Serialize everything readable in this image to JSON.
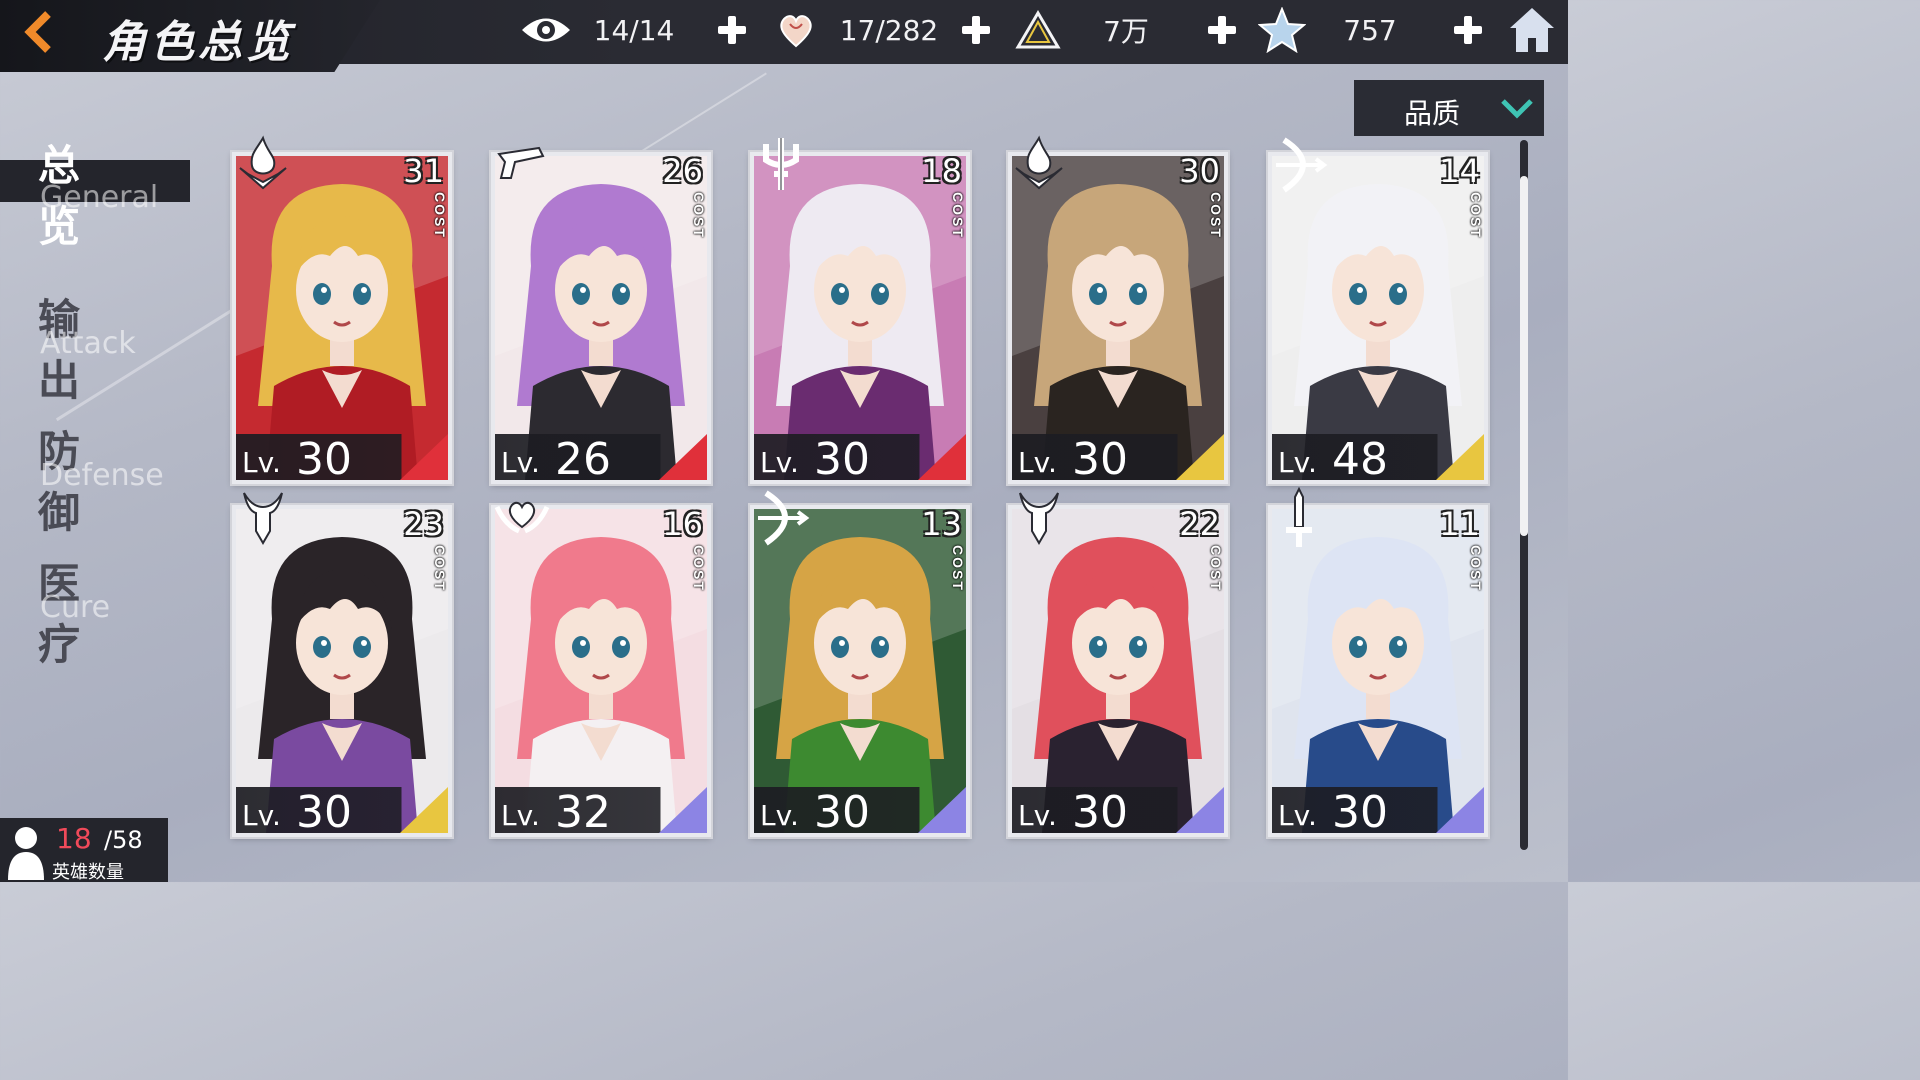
{
  "header": {
    "title": "角色总览",
    "resources": [
      {
        "icon": "eye-icon",
        "value": "14/14"
      },
      {
        "icon": "heart-icon",
        "value": "17/282"
      },
      {
        "icon": "crystal-triangle-icon",
        "value": "7万"
      },
      {
        "icon": "star-icon",
        "value": "757"
      }
    ]
  },
  "sort": {
    "label": "品质"
  },
  "categories": [
    {
      "zh": "总览",
      "en": "General",
      "active": true
    },
    {
      "zh": "输出",
      "en": "Attack",
      "active": false
    },
    {
      "zh": "防御",
      "en": "Defense",
      "active": false
    },
    {
      "zh": "医疗",
      "en": "Cure",
      "active": false
    }
  ],
  "card_common": {
    "cost_label": "COST",
    "lv_prefix": "Lv."
  },
  "cards": [
    {
      "class": "fire-class-icon",
      "cost": "31",
      "level": "30",
      "rarity_color": "#e0303a",
      "hair": "#e7b94a",
      "outfit": "#b01c24",
      "bg": "#c52a30"
    },
    {
      "class": "gun-class-icon",
      "cost": "26",
      "level": "26",
      "rarity_color": "#e0303a",
      "hair": "#b07ad0",
      "outfit": "#2c2a30",
      "bg": "#f2e8ea"
    },
    {
      "class": "trident-class-icon",
      "cost": "18",
      "level": "30",
      "rarity_color": "#e0303a",
      "hair": "#eeeaf2",
      "outfit": "#6a2c70",
      "bg": "#c87cb4"
    },
    {
      "class": "fire-class-icon",
      "cost": "30",
      "level": "30",
      "rarity_color": "#e8c640",
      "hair": "#c7a67a",
      "outfit": "#2a2420",
      "bg": "#4a4040"
    },
    {
      "class": "bow-class-icon",
      "cost": "14",
      "level": "48",
      "rarity_color": "#e8c640",
      "hair": "#f2f2f6",
      "outfit": "#3a3a44",
      "bg": "#eeeeee"
    },
    {
      "class": "horned-class-icon",
      "cost": "23",
      "level": "30",
      "rarity_color": "#e8c640",
      "hair": "#2a2428",
      "outfit": "#7a4aa0",
      "bg": "#eceaec"
    },
    {
      "class": "heart-wing-class-icon",
      "cost": "16",
      "level": "32",
      "rarity_color": "#8c84e4",
      "hair": "#f07a8c",
      "outfit": "#f4f0f2",
      "bg": "#f4dde2"
    },
    {
      "class": "bow-class-icon",
      "cost": "13",
      "level": "30",
      "rarity_color": "#8c84e4",
      "hair": "#d6a445",
      "outfit": "#3d8a30",
      "bg": "#2f5a34"
    },
    {
      "class": "horned-class-icon",
      "cost": "22",
      "level": "30",
      "rarity_color": "#8c84e4",
      "hair": "#e0505c",
      "outfit": "#2a2230",
      "bg": "#e4dfe4"
    },
    {
      "class": "sword-class-icon",
      "cost": "11",
      "level": "30",
      "rarity_color": "#8c84e4",
      "hair": "#dde4f4",
      "outfit": "#284b8a",
      "bg": "#dfe4ee"
    }
  ],
  "hero_count": {
    "current": "18",
    "max": "/58",
    "label": "英雄数量"
  }
}
